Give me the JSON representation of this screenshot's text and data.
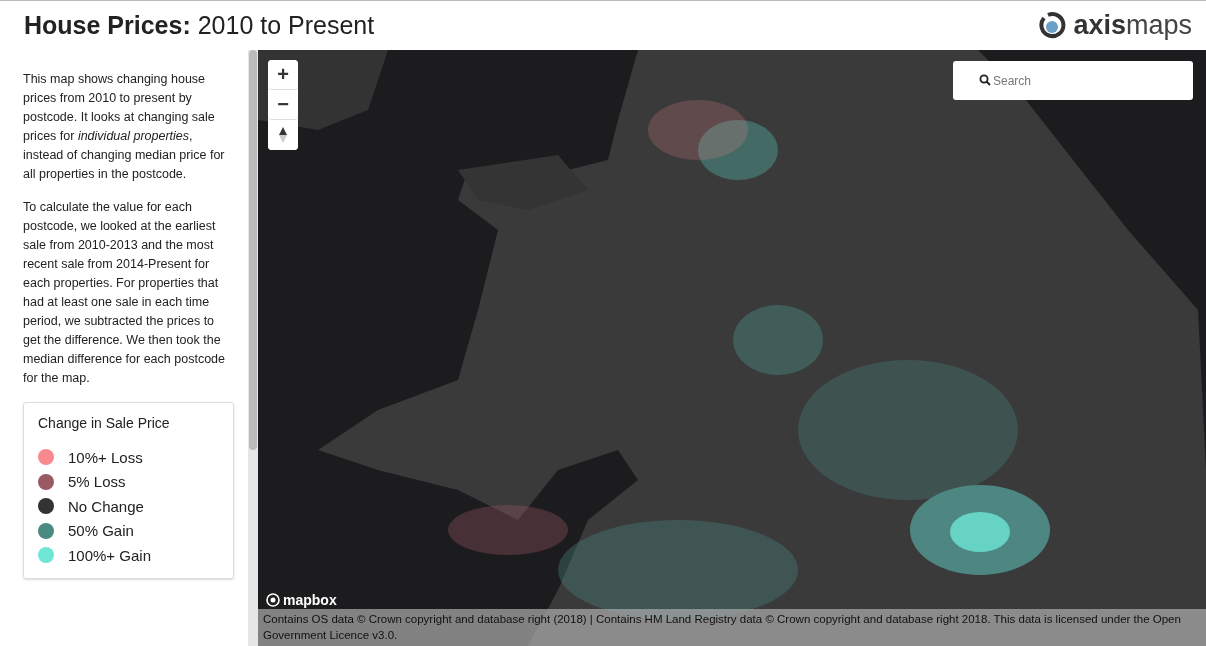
{
  "header": {
    "title_bold": "House Prices:",
    "title_rest": "2010 to Present",
    "logo": {
      "bold": "axis",
      "light": "maps"
    }
  },
  "sidebar": {
    "paragraphs": [
      "This map shows changing house prices from 2010 to present by postcode. It looks at changing sale prices for *individual properties*, instead of changing median price for all properties in the postcode.",
      "To calculate the value for each postcode, we looked at the earliest sale from 2010-2013 and the most recent sale from 2014-Present for each properties. For properties that had at least one sale in each time period, we subtracted the prices to get the difference. We then took the median difference for each postcode for the map."
    ],
    "legend": {
      "title": "Change in Sale Price",
      "items": [
        {
          "label": "10%+ Loss",
          "color": "#f88a8f"
        },
        {
          "label": "5% Loss",
          "color": "#9a5a64"
        },
        {
          "label": "No Change",
          "color": "#333333"
        },
        {
          "label": "50% Gain",
          "color": "#4a8a80"
        },
        {
          "label": "100%+ Gain",
          "color": "#6ee6d6"
        }
      ]
    }
  },
  "map": {
    "kind": "picture",
    "zoom_controls": [
      "+",
      "−"
    ],
    "search": {
      "placeholder": "Search"
    },
    "mapbox_logo": "mapbox",
    "attribution": "Contains OS data © Crown copyright and database right (2018) | Contains HM Land Registry data © Crown copyright and database right 2018. This data is licensed under the Open Government Licence v3.0."
  }
}
